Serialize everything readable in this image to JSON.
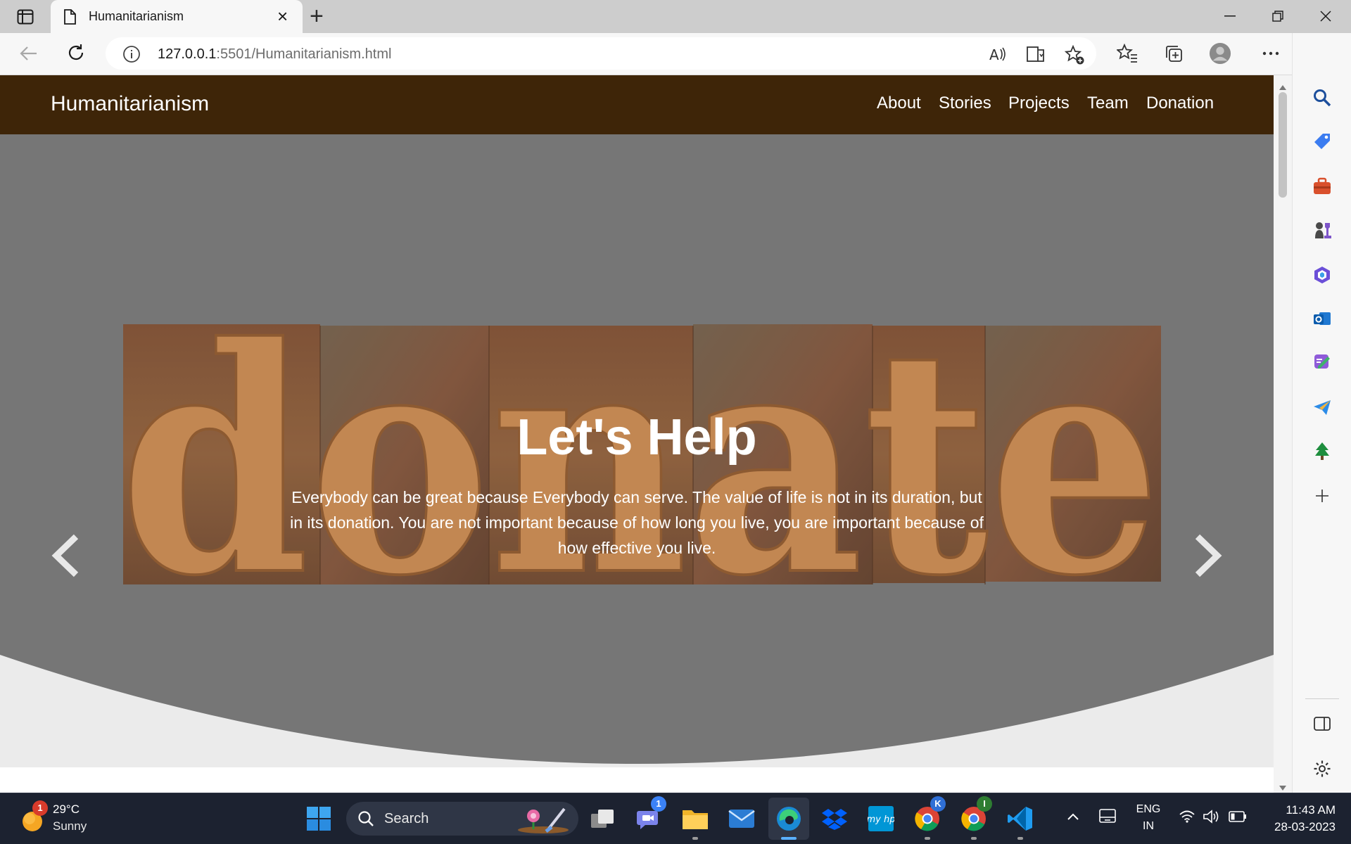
{
  "browser": {
    "tab_title": "Humanitarianism",
    "url_host": "127.0.0.1",
    "url_rest": ":5501/Humanitarianism.html"
  },
  "site": {
    "brand": "Humanitarianism",
    "nav": [
      "About",
      "Stories",
      "Projects",
      "Team",
      "Donation"
    ],
    "hero_image_word": "donate",
    "hero_title": "Let's Help",
    "hero_text": "Everybody can be great because Everybody can serve. The value of life is not in its duration, but in its donation. You are not important because of how long you live, you are important because of how effective you live."
  },
  "taskbar": {
    "weather_temp": "29°C",
    "weather_desc": "Sunny",
    "weather_badge": "1",
    "search_label": "Search",
    "teams_badge": "1",
    "chrome1_badge": "K",
    "chrome2_badge": "I",
    "lang_line1": "ENG",
    "lang_line2": "IN",
    "time": "11:43 AM",
    "date": "28-03-2023"
  },
  "colors": {
    "nav_bg": "#3e2508",
    "hero_overlay": "#808080",
    "taskbar_bg": "#1c2230",
    "edge_blue": "#1f6feb"
  }
}
